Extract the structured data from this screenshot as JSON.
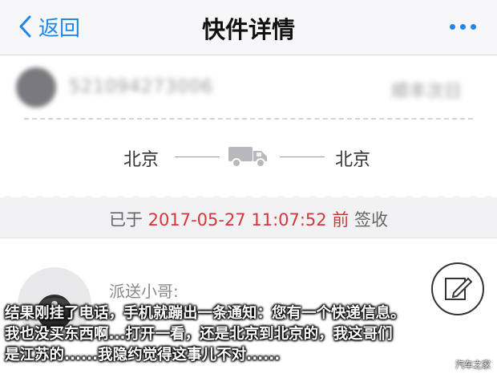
{
  "nav": {
    "back_label": "返回",
    "title": "快件详情"
  },
  "tracking": {
    "number_blurred": "521094273006",
    "carrier_blurred": "顺丰次日"
  },
  "route": {
    "from": "北京",
    "to": "北京"
  },
  "signed": {
    "prefix": "已于",
    "time": "2017-05-27 11:07:52",
    "suffix": "前 签收"
  },
  "courier": {
    "label": "派送小哥:"
  },
  "caption": {
    "line1": "结果刚挂了电话，手机就蹦出一条通知：您有一个快递信息。",
    "line2": "我也没买东西啊...打开一看，还是北京到北京的，我这哥们",
    "line3": "是江苏的......我隐约觉得这事儿不对......"
  },
  "watermark": "汽车之家",
  "colors": {
    "accent": "#1f87e8",
    "signed_time": "#d4383a"
  },
  "icons": [
    "chevron-left-icon",
    "more-icon",
    "truck-icon",
    "edit-icon"
  ]
}
